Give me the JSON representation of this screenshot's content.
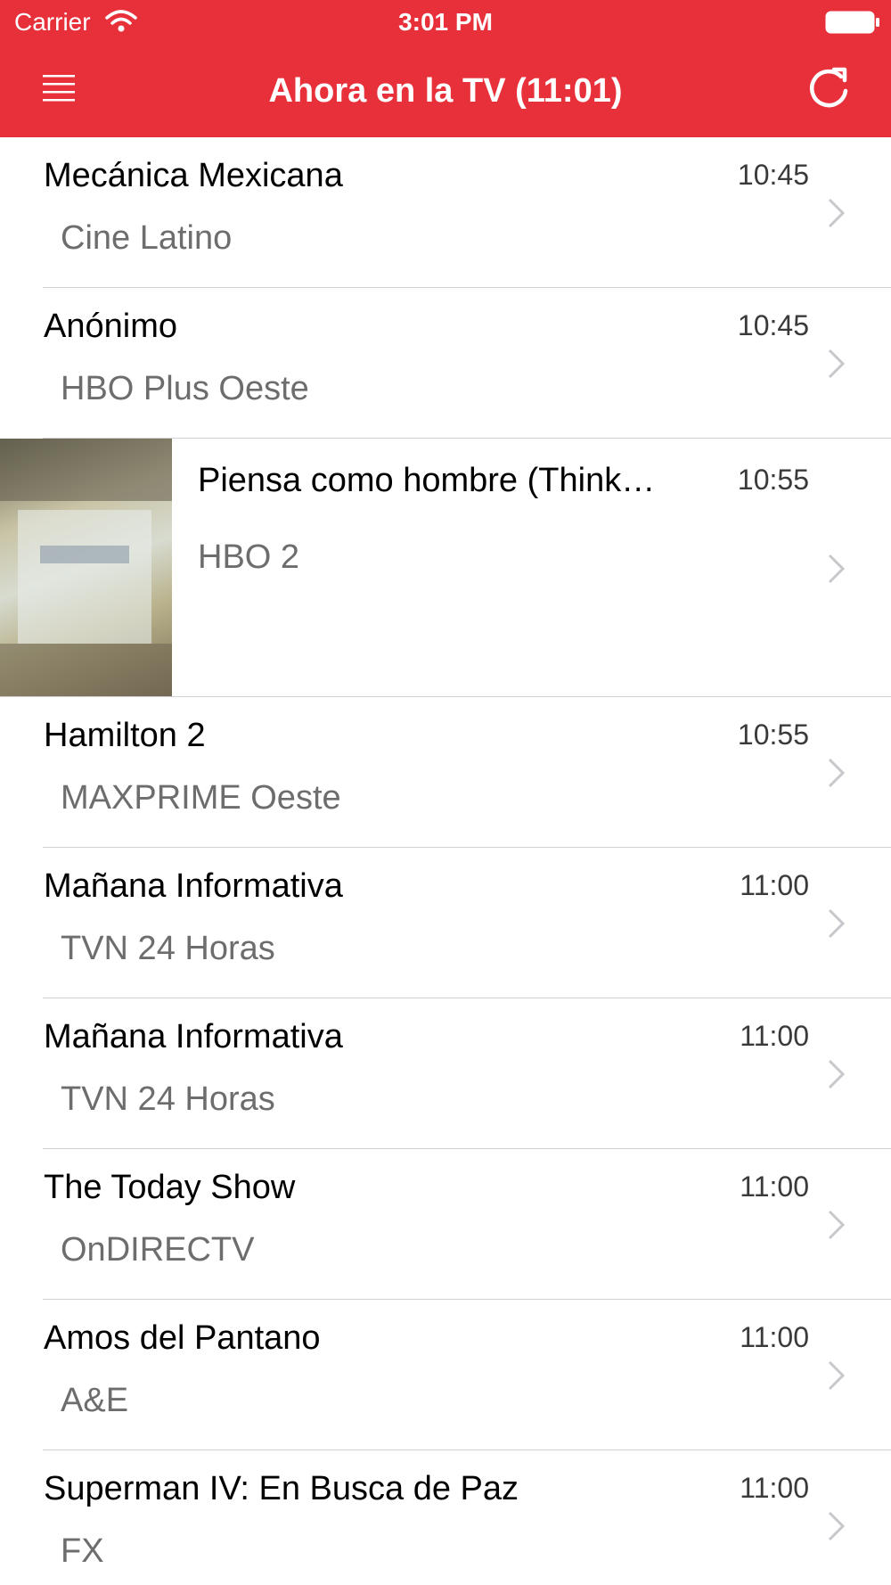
{
  "status_bar": {
    "carrier": "Carrier",
    "time": "3:01 PM"
  },
  "nav": {
    "title": "Ahora en la TV (11:01)",
    "menu_icon": "hamburger-menu-icon",
    "refresh_icon": "refresh-icon"
  },
  "colors": {
    "header": "#E8303B",
    "title_text": "#000000",
    "channel_text": "#6d6d6d",
    "separator": "#d0d0d4",
    "chevron": "#c7c7cc"
  },
  "programs": [
    {
      "title": "Mecánica Mexicana",
      "channel": "Cine Latino",
      "time": "10:45"
    },
    {
      "title": "Anónimo",
      "channel": "HBO Plus Oeste",
      "time": "10:45"
    },
    {
      "title": "Piensa como hombre (Think…",
      "channel": "HBO 2",
      "time": "10:55",
      "has_thumbnail": true
    },
    {
      "title": "Hamilton 2",
      "channel": "MAXPRIME Oeste",
      "time": "10:55"
    },
    {
      "title": "Mañana Informativa",
      "channel": "TVN 24 Horas",
      "time": "11:00"
    },
    {
      "title": "Mañana Informativa",
      "channel": "TVN 24 Horas",
      "time": "11:00"
    },
    {
      "title": "The Today Show",
      "channel": "OnDIRECTV",
      "time": "11:00"
    },
    {
      "title": "Amos del Pantano",
      "channel": "A&E",
      "time": "11:00"
    },
    {
      "title": "Superman IV: En Busca de Paz",
      "channel": "FX",
      "time": "11:00"
    }
  ]
}
